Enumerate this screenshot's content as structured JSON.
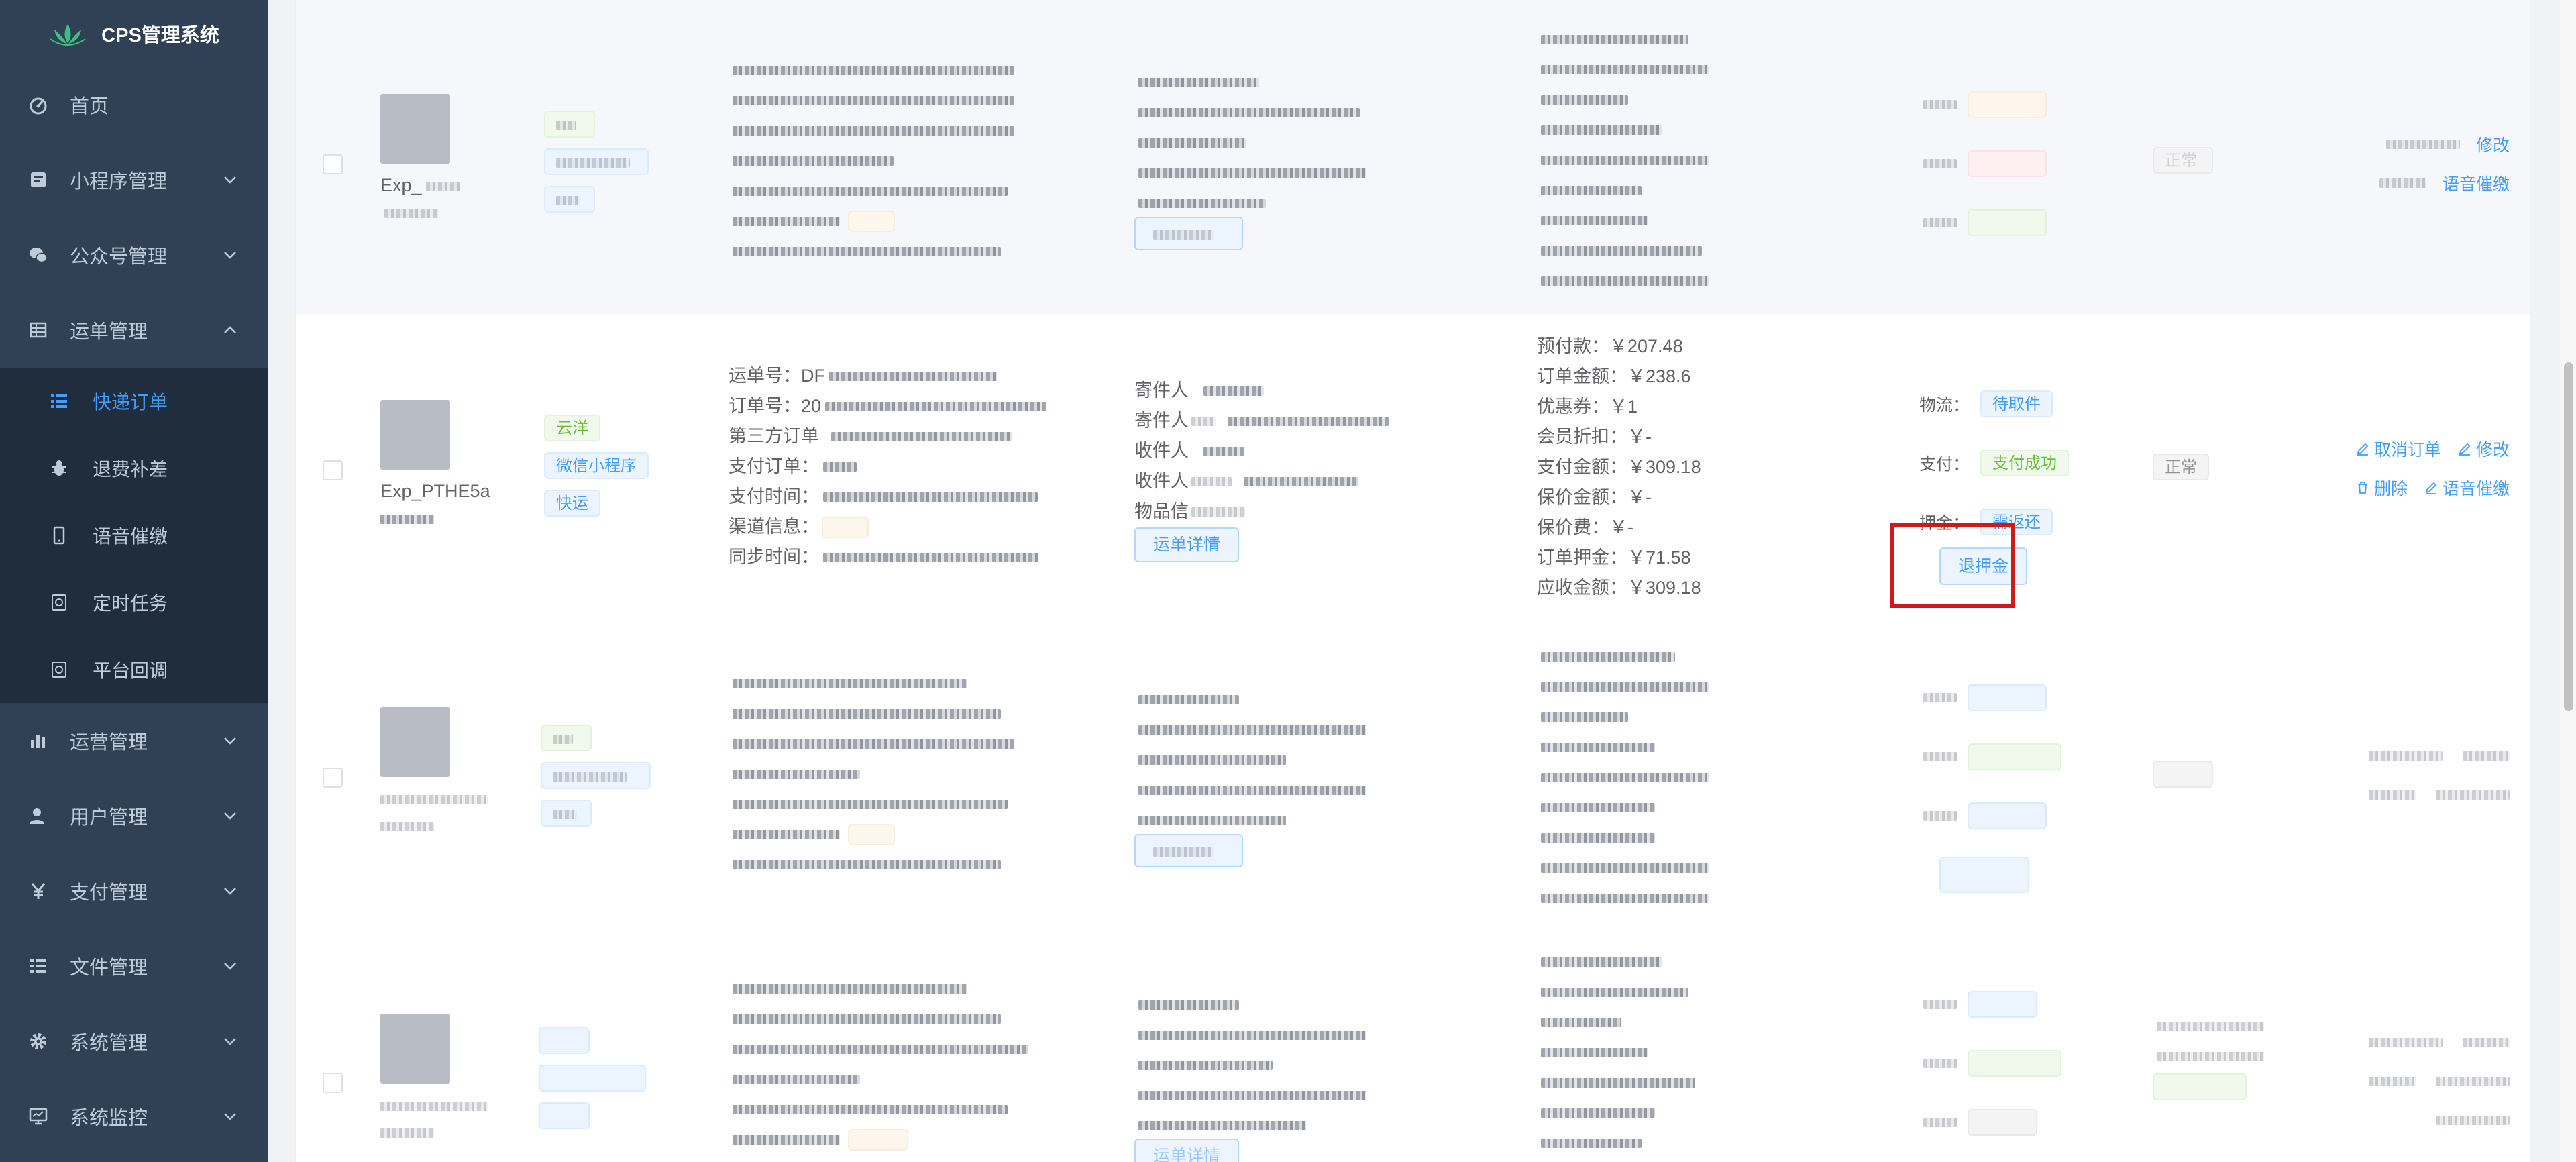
{
  "app": {
    "title": "CPS管理系统"
  },
  "sidebar": {
    "items": [
      {
        "label": "首页",
        "icon": "dashboard-icon"
      },
      {
        "label": "小程序管理",
        "icon": "miniprogram-icon"
      },
      {
        "label": "公众号管理",
        "icon": "wechat-icon"
      },
      {
        "label": "运单管理",
        "icon": "table-icon",
        "expanded": true
      },
      {
        "label": "运营管理",
        "icon": "chart-icon"
      },
      {
        "label": "用户管理",
        "icon": "user-icon"
      },
      {
        "label": "支付管理",
        "icon": "yen-icon"
      },
      {
        "label": "文件管理",
        "icon": "list-icon"
      },
      {
        "label": "系统管理",
        "icon": "gear-icon"
      },
      {
        "label": "系统监控",
        "icon": "monitor-icon"
      }
    ],
    "submenu": [
      {
        "label": "快递订单",
        "icon": "list-icon",
        "active": true
      },
      {
        "label": "退费补差",
        "icon": "bug-icon"
      },
      {
        "label": "语音催缴",
        "icon": "phone-icon"
      },
      {
        "label": "定时任务",
        "icon": "clock-icon"
      },
      {
        "label": "平台回调",
        "icon": "callback-icon"
      }
    ]
  },
  "orders": {
    "detail_row": {
      "user_id": "Exp_PTHE5a",
      "tags": [
        {
          "text": "云洋",
          "color": "green"
        },
        {
          "text": "微信小程序",
          "color": "blue"
        },
        {
          "text": "快运",
          "color": "blue"
        }
      ],
      "order_info": {
        "waybill_label": "运单号：",
        "waybill_value": "DF",
        "order_no_label": "订单号：",
        "order_no_value": "20",
        "third_party_label": "第三方订单",
        "pay_order_label": "支付订单：",
        "pay_time_label": "支付时间：",
        "channel_label": "渠道信息：",
        "sync_time_label": "同步时间："
      },
      "sender": {
        "sender_label": "寄件人",
        "sender_phone_label": "寄件人",
        "receiver_label": "收件人",
        "receiver_phone_label": "收件人",
        "goods_label": "物品信",
        "detail_button": "运单详情"
      },
      "fees": [
        {
          "label": "预付款：",
          "value": "￥207.48"
        },
        {
          "label": "订单金额：",
          "value": "￥238.6"
        },
        {
          "label": "优惠券：",
          "value": "￥1"
        },
        {
          "label": "会员折扣：",
          "value": "￥-"
        },
        {
          "label": "支付金额：",
          "value": "￥309.18"
        },
        {
          "label": "保价金额：",
          "value": "￥-"
        },
        {
          "label": "保价费：",
          "value": "￥-"
        },
        {
          "label": "订单押金：",
          "value": "￥71.58"
        },
        {
          "label": "应收金额：",
          "value": "￥309.18"
        }
      ],
      "status": [
        {
          "label": "物流：",
          "value": "待取件",
          "color": "blue"
        },
        {
          "label": "支付：",
          "value": "支付成功",
          "color": "green"
        },
        {
          "label": "押金：",
          "value": "需返还",
          "color": "blue"
        }
      ],
      "refund_deposit_button": "退押金",
      "state": "正常",
      "ops": {
        "cancel_order": "取消订单",
        "modify": "修改",
        "delete": "删除",
        "voice_collect": "语音催缴"
      }
    },
    "row1_user": "Exp_",
    "row1_ops": {
      "modify": "修改",
      "voice_collect": "语音催缴"
    },
    "row1_state": "正常",
    "row4_detail_button": "运单详情"
  },
  "colors": {
    "sidebar_bg": "#304156",
    "submenu_bg": "#1f2d3d",
    "accent": "#409eff",
    "highlight": "#d0191a"
  }
}
